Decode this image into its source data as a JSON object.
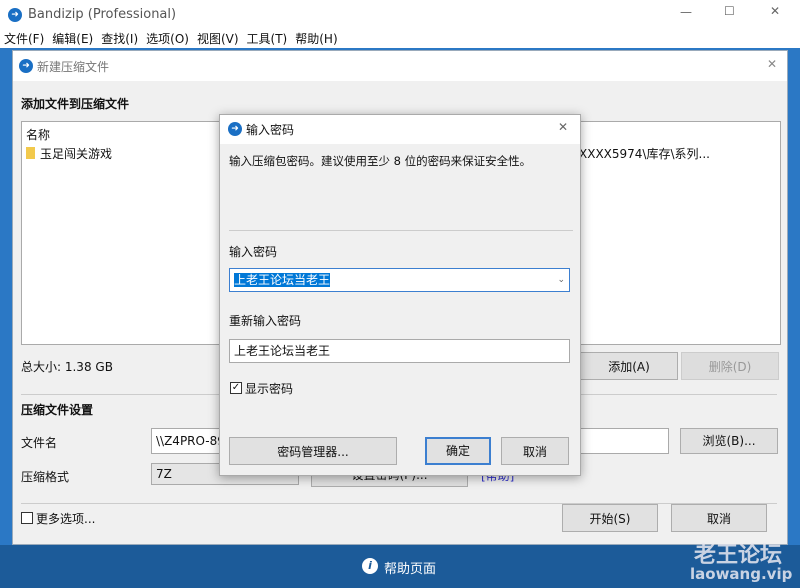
{
  "app": {
    "title": "Bandizip (Professional)",
    "menu": [
      "文件(F)",
      "编辑(E)",
      "查找(I)",
      "选项(O)",
      "视图(V)",
      "工具(T)",
      "帮助(H)"
    ]
  },
  "main": {
    "title": "新建压缩文件",
    "section_add": "添加文件到压缩文件",
    "column_name": "名称",
    "files": [
      {
        "name": "玉足闯关游戏",
        "path": "XXXX5974\\库存\\系列..."
      }
    ],
    "total_size": "总大小: 1.38 GB",
    "add_button": "添加(A)",
    "delete_button": "删除(D)",
    "section_settings": "压缩文件设置",
    "filename_label": "文件名",
    "filename_value": "\\\\Z4PRO-89",
    "browse_button": "浏览(B)...",
    "format_label": "压缩格式",
    "format_value": "7Z",
    "set_password_button": "设置密码(P)...",
    "help_link": "[帮助]",
    "more_options": "更多选项...",
    "start_button": "开始(S)",
    "cancel_button": "取消"
  },
  "footer": {
    "help_page": "帮助页面",
    "watermark": "老王论坛",
    "watermark_url": "laowang.vip"
  },
  "password_dialog": {
    "title": "输入密码",
    "description": "输入压缩包密码。建议使用至少 8 位的密码来保证安全性。",
    "password_label": "输入密码",
    "password_value": "上老王论坛当老王",
    "confirm_label": "重新输入密码",
    "confirm_value": "上老王论坛当老王",
    "show_password": "显示密码",
    "show_password_checked": true,
    "manager_button": "密码管理器...",
    "ok_button": "确定",
    "cancel_button": "取消"
  }
}
